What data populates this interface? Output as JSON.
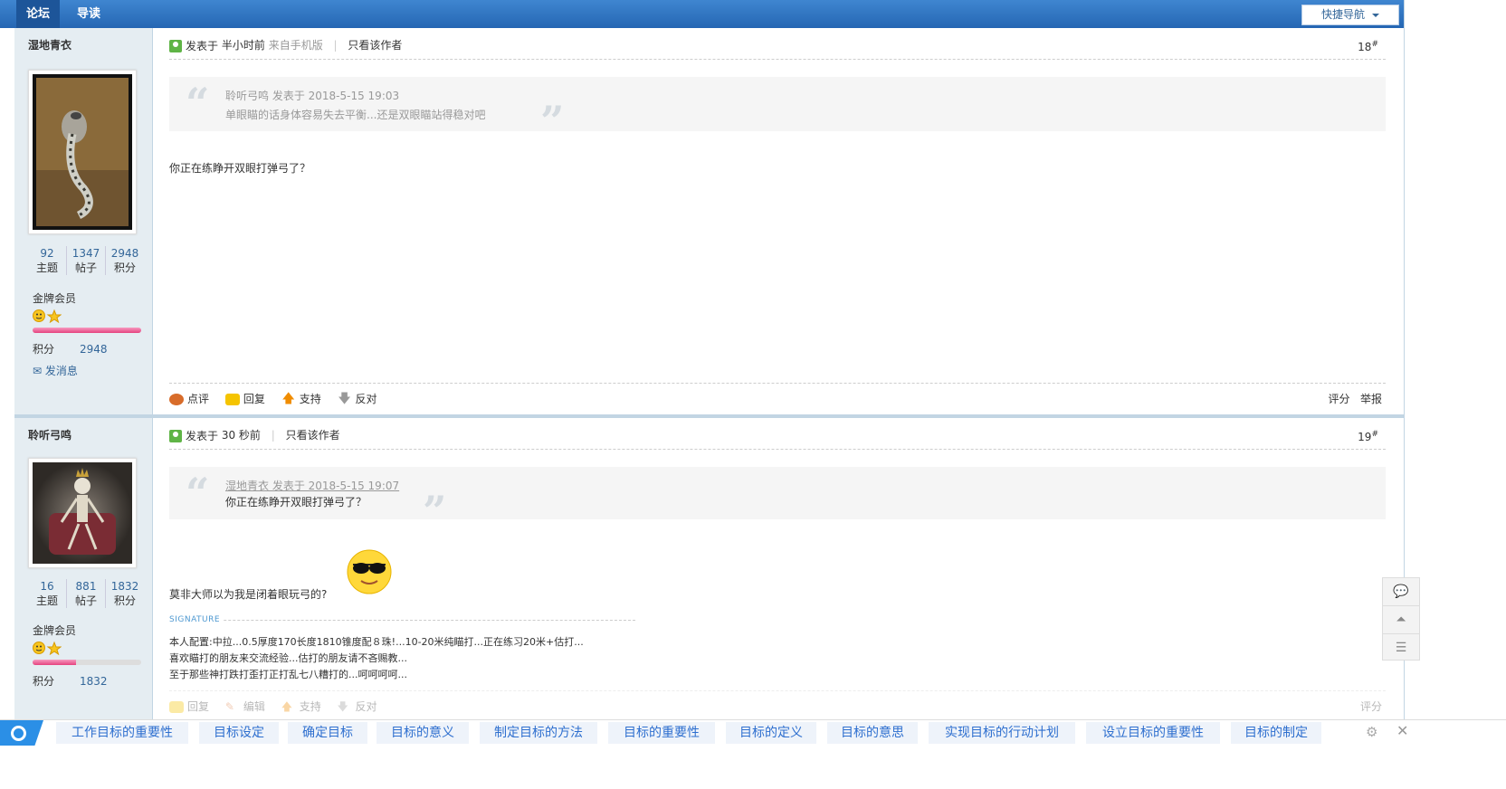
{
  "nav": {
    "tabs": [
      "论坛",
      "导读"
    ],
    "quicknav": "快捷导航"
  },
  "posts": [
    {
      "author": "湿地青衣",
      "stats": [
        {
          "num": "92",
          "label": "主题"
        },
        {
          "num": "1347",
          "label": "帖子"
        },
        {
          "num": "2948",
          "label": "积分"
        }
      ],
      "rank": "金牌会员",
      "credit_label": "积分",
      "credit_value": "2948",
      "credit_bar_fraction": 1.0,
      "send_msg": "发消息",
      "header": {
        "prefix": "发表于",
        "time": "半小时前",
        "source": "来自手机版",
        "only_author": "只看该作者",
        "floor": "18",
        "floor_sup": "#"
      },
      "quote": {
        "line1": "聆听弓鸣 发表于 2018-5-15 19:03",
        "line2": "单眼瞄的话身体容易失去平衡...还是双眼瞄站得稳对吧"
      },
      "content": "你正在练睁开双眼打弹弓了？",
      "footer": {
        "actions": [
          "点评",
          "回复",
          "支持",
          "反对"
        ],
        "right": [
          "评分",
          "举报"
        ]
      }
    },
    {
      "author": "聆听弓鸣",
      "stats": [
        {
          "num": "16",
          "label": "主题"
        },
        {
          "num": "881",
          "label": "帖子"
        },
        {
          "num": "1832",
          "label": "积分"
        }
      ],
      "rank": "金牌会员",
      "credit_label": "积分",
      "credit_value": "1832",
      "credit_bar_fraction": 0.4,
      "header": {
        "prefix": "发表于",
        "time": "30 秒前",
        "only_author": "只看该作者",
        "floor": "19",
        "floor_sup": "#"
      },
      "quote": {
        "line1": "湿地青衣 发表于 2018-5-15 19:07",
        "line2": "你正在练睁开双眼打弹弓了？"
      },
      "content": "莫非大师以为我是闭着眼玩弓的?",
      "signature_label": "SIGNATURE",
      "signature": [
        "本人配置:中拉...0.5厚度170长度1810锥度配８珠!...10-20米纯瞄打...正在练习20米+估打...",
        "喜欢瞄打的朋友来交流经验...估打的朋友请不吝赐教...",
        "至于那些神打跌打歪打正打乱七八糟打的...呵呵呵呵..."
      ],
      "footer": {
        "actions": [
          "回复",
          "编辑",
          "支持",
          "反对"
        ],
        "right": [
          "评分"
        ]
      }
    }
  ],
  "bottom_keywords": [
    "工作目标的重要性",
    "目标设定",
    "确定目标",
    "目标的意义",
    "制定目标的方法",
    "目标的重要性",
    "目标的定义",
    "目标的意思",
    "实现目标的行动计划",
    "设立目标的重要性",
    "目标的制定"
  ],
  "colors": {
    "nav_blue": "#2b6cb6",
    "sidebar_bg": "#e5edf2",
    "link": "#336699",
    "keyword_bg": "#eef3fa"
  },
  "icons": [
    "online-icon",
    "comment-icon",
    "reply-icon",
    "support-icon",
    "oppose-icon",
    "envelope-icon",
    "cool-emoji-icon",
    "gear-icon",
    "close-icon",
    "search-logo-icon"
  ]
}
